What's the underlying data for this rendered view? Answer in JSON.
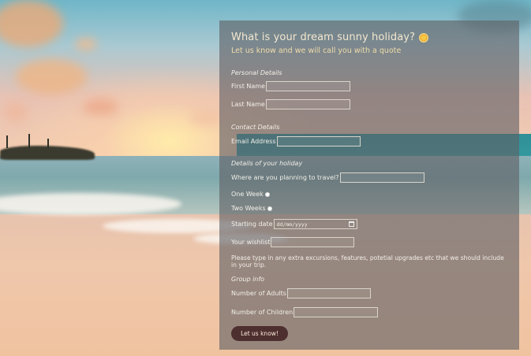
{
  "form": {
    "title": "What is your dream sunny holiday?",
    "title_icon": "sun-icon",
    "subtitle": "Let us know and we will call you with a quote",
    "personal_section": "Personal Details",
    "first_name_label": "First Name",
    "first_name_value": "",
    "last_name_label": "Last Name",
    "last_name_value": "",
    "contact_section": "Contact Details",
    "email_label": "Email Address",
    "email_value": "",
    "holiday_section": "Details of your holiday",
    "destination_label": "Where are you planning to travel?",
    "destination_value": "",
    "one_week_label": "One Week",
    "two_weeks_label": "Two Weeks",
    "start_date_label": "Starting date",
    "start_date_placeholder": "dd/mm/yyyy",
    "wishlist_label": "Your wishlist",
    "wishlist_value": "",
    "wishlist_note": "Please type in any extra excursions, features, potetial upgrades etc that we should include in your trip.",
    "group_section": "Group info",
    "adults_label": "Number of Adults",
    "adults_value": "",
    "children_label": "Number of Children",
    "children_value": "",
    "submit_label": "Let us know!"
  },
  "colors": {
    "panel_bg": "#5f5f64",
    "title": "#f3e7cf",
    "subtitle": "#f0dcaa",
    "button_bg": "#4e2f2f",
    "button_text": "#f6ead8"
  }
}
